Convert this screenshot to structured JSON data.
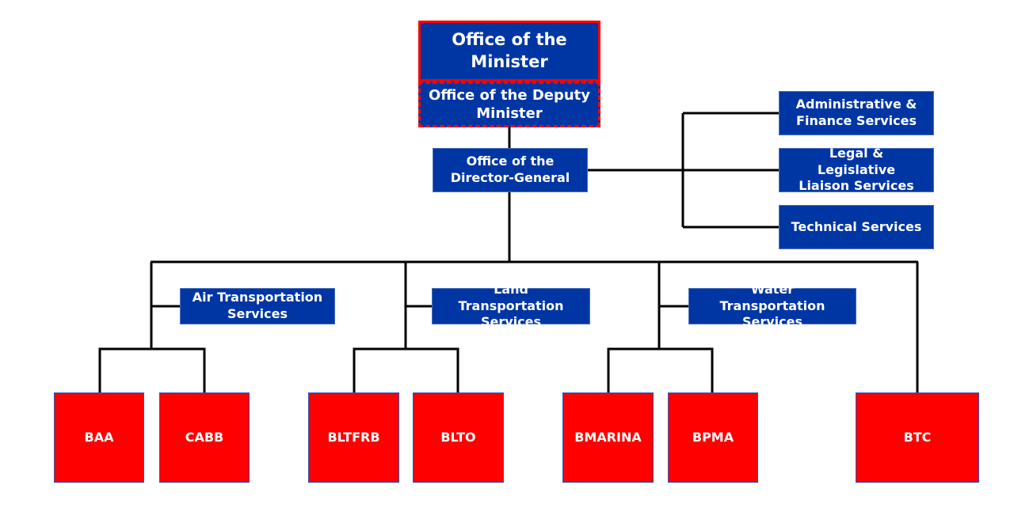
{
  "colors": {
    "blue": "#0036A4",
    "red": "#FF0000",
    "line": "#000000"
  },
  "nodes": {
    "minister": "Office of the Minister",
    "deputy": "Office of the Deputy Minister",
    "dg": "Office of the Director-General",
    "admin": "Administrative & Finance Services",
    "legal": "Legal & Legislative Liaison Services",
    "technical": "Technical Services",
    "air": "Air Transportation Services",
    "land": "Land Transportation Services",
    "water": "Water Transportation Services",
    "baa": "BAA",
    "cabb": "CABB",
    "bltfrb": "BLTFRB",
    "blto": "BLTO",
    "bmarina": "BMARINA",
    "bpma": "BPMA",
    "btc": "BTC"
  }
}
